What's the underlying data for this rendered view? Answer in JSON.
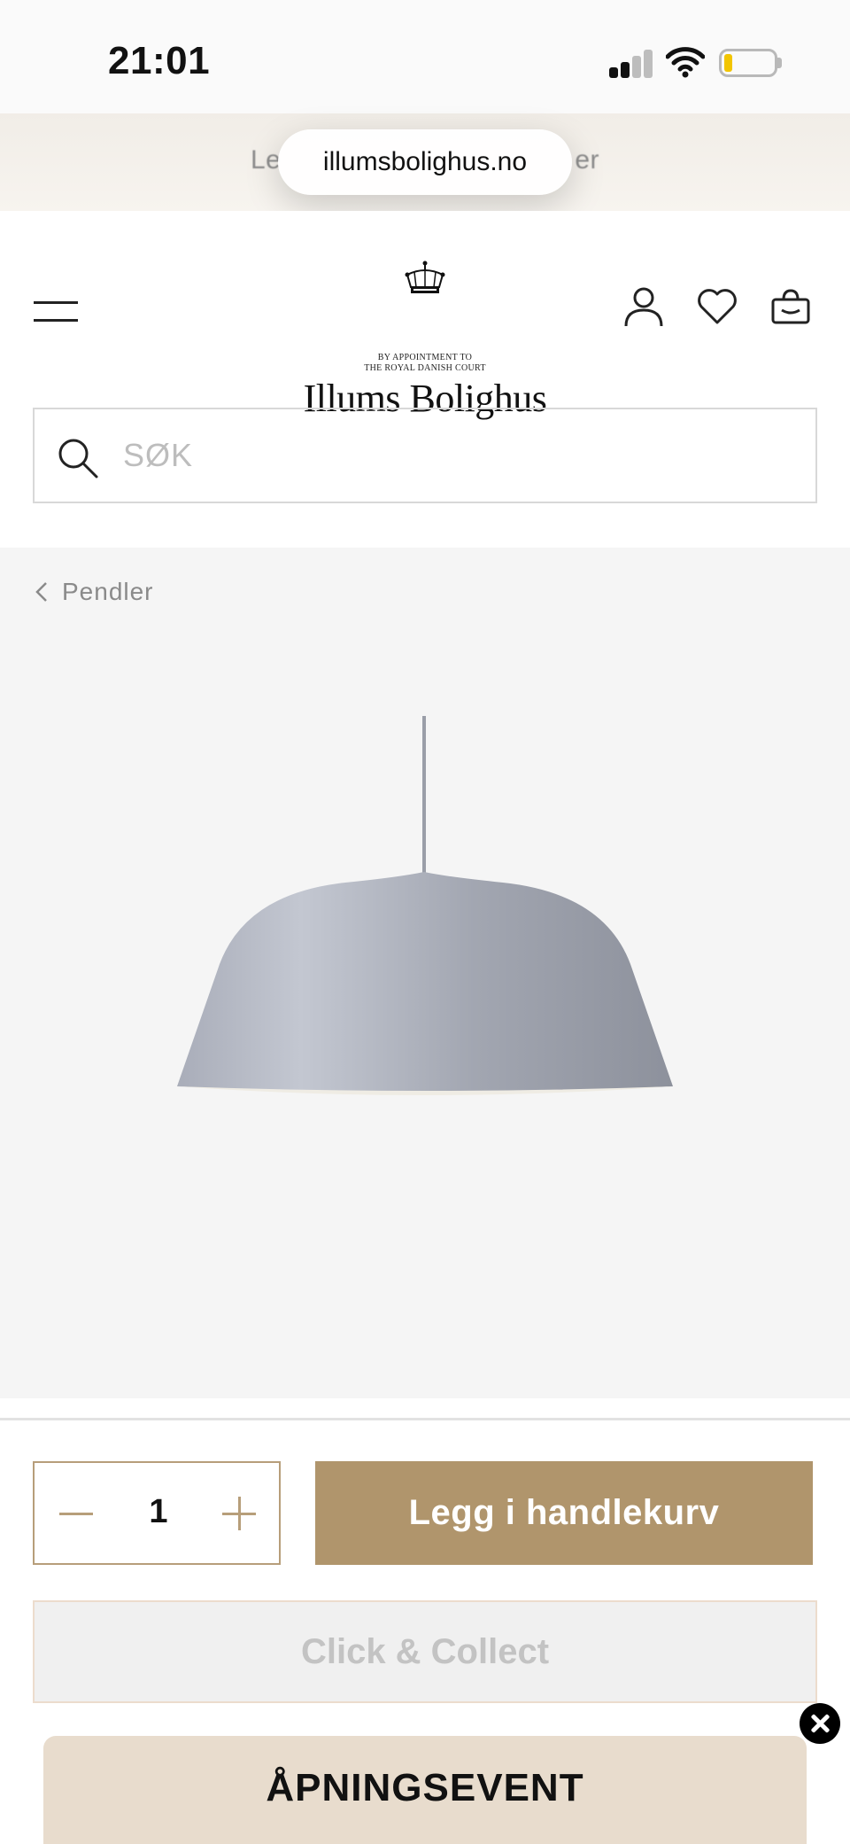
{
  "status_bar": {
    "time": "21:01",
    "battery_color": "#f2c500"
  },
  "banner": {
    "text_start": "Le",
    "text_end": "er"
  },
  "browser": {
    "url": "illumsbolighus.no"
  },
  "header": {
    "logo_appointment_line1": "BY APPOINTMENT TO",
    "logo_appointment_line2": "THE ROYAL DANISH COURT",
    "logo_name": "Illums Bolighus",
    "icons": [
      "menu-icon",
      "account-icon",
      "heart-icon",
      "basket-icon"
    ]
  },
  "search": {
    "placeholder": "SØK"
  },
  "product": {
    "breadcrumb": "Pendler",
    "quantity": "1",
    "add_to_cart_label": "Legg i handlekurv",
    "click_collect_label": "Click & Collect",
    "accent_color": "#b0956c"
  },
  "promo": {
    "title": "ÅPNINGSEVENT"
  }
}
